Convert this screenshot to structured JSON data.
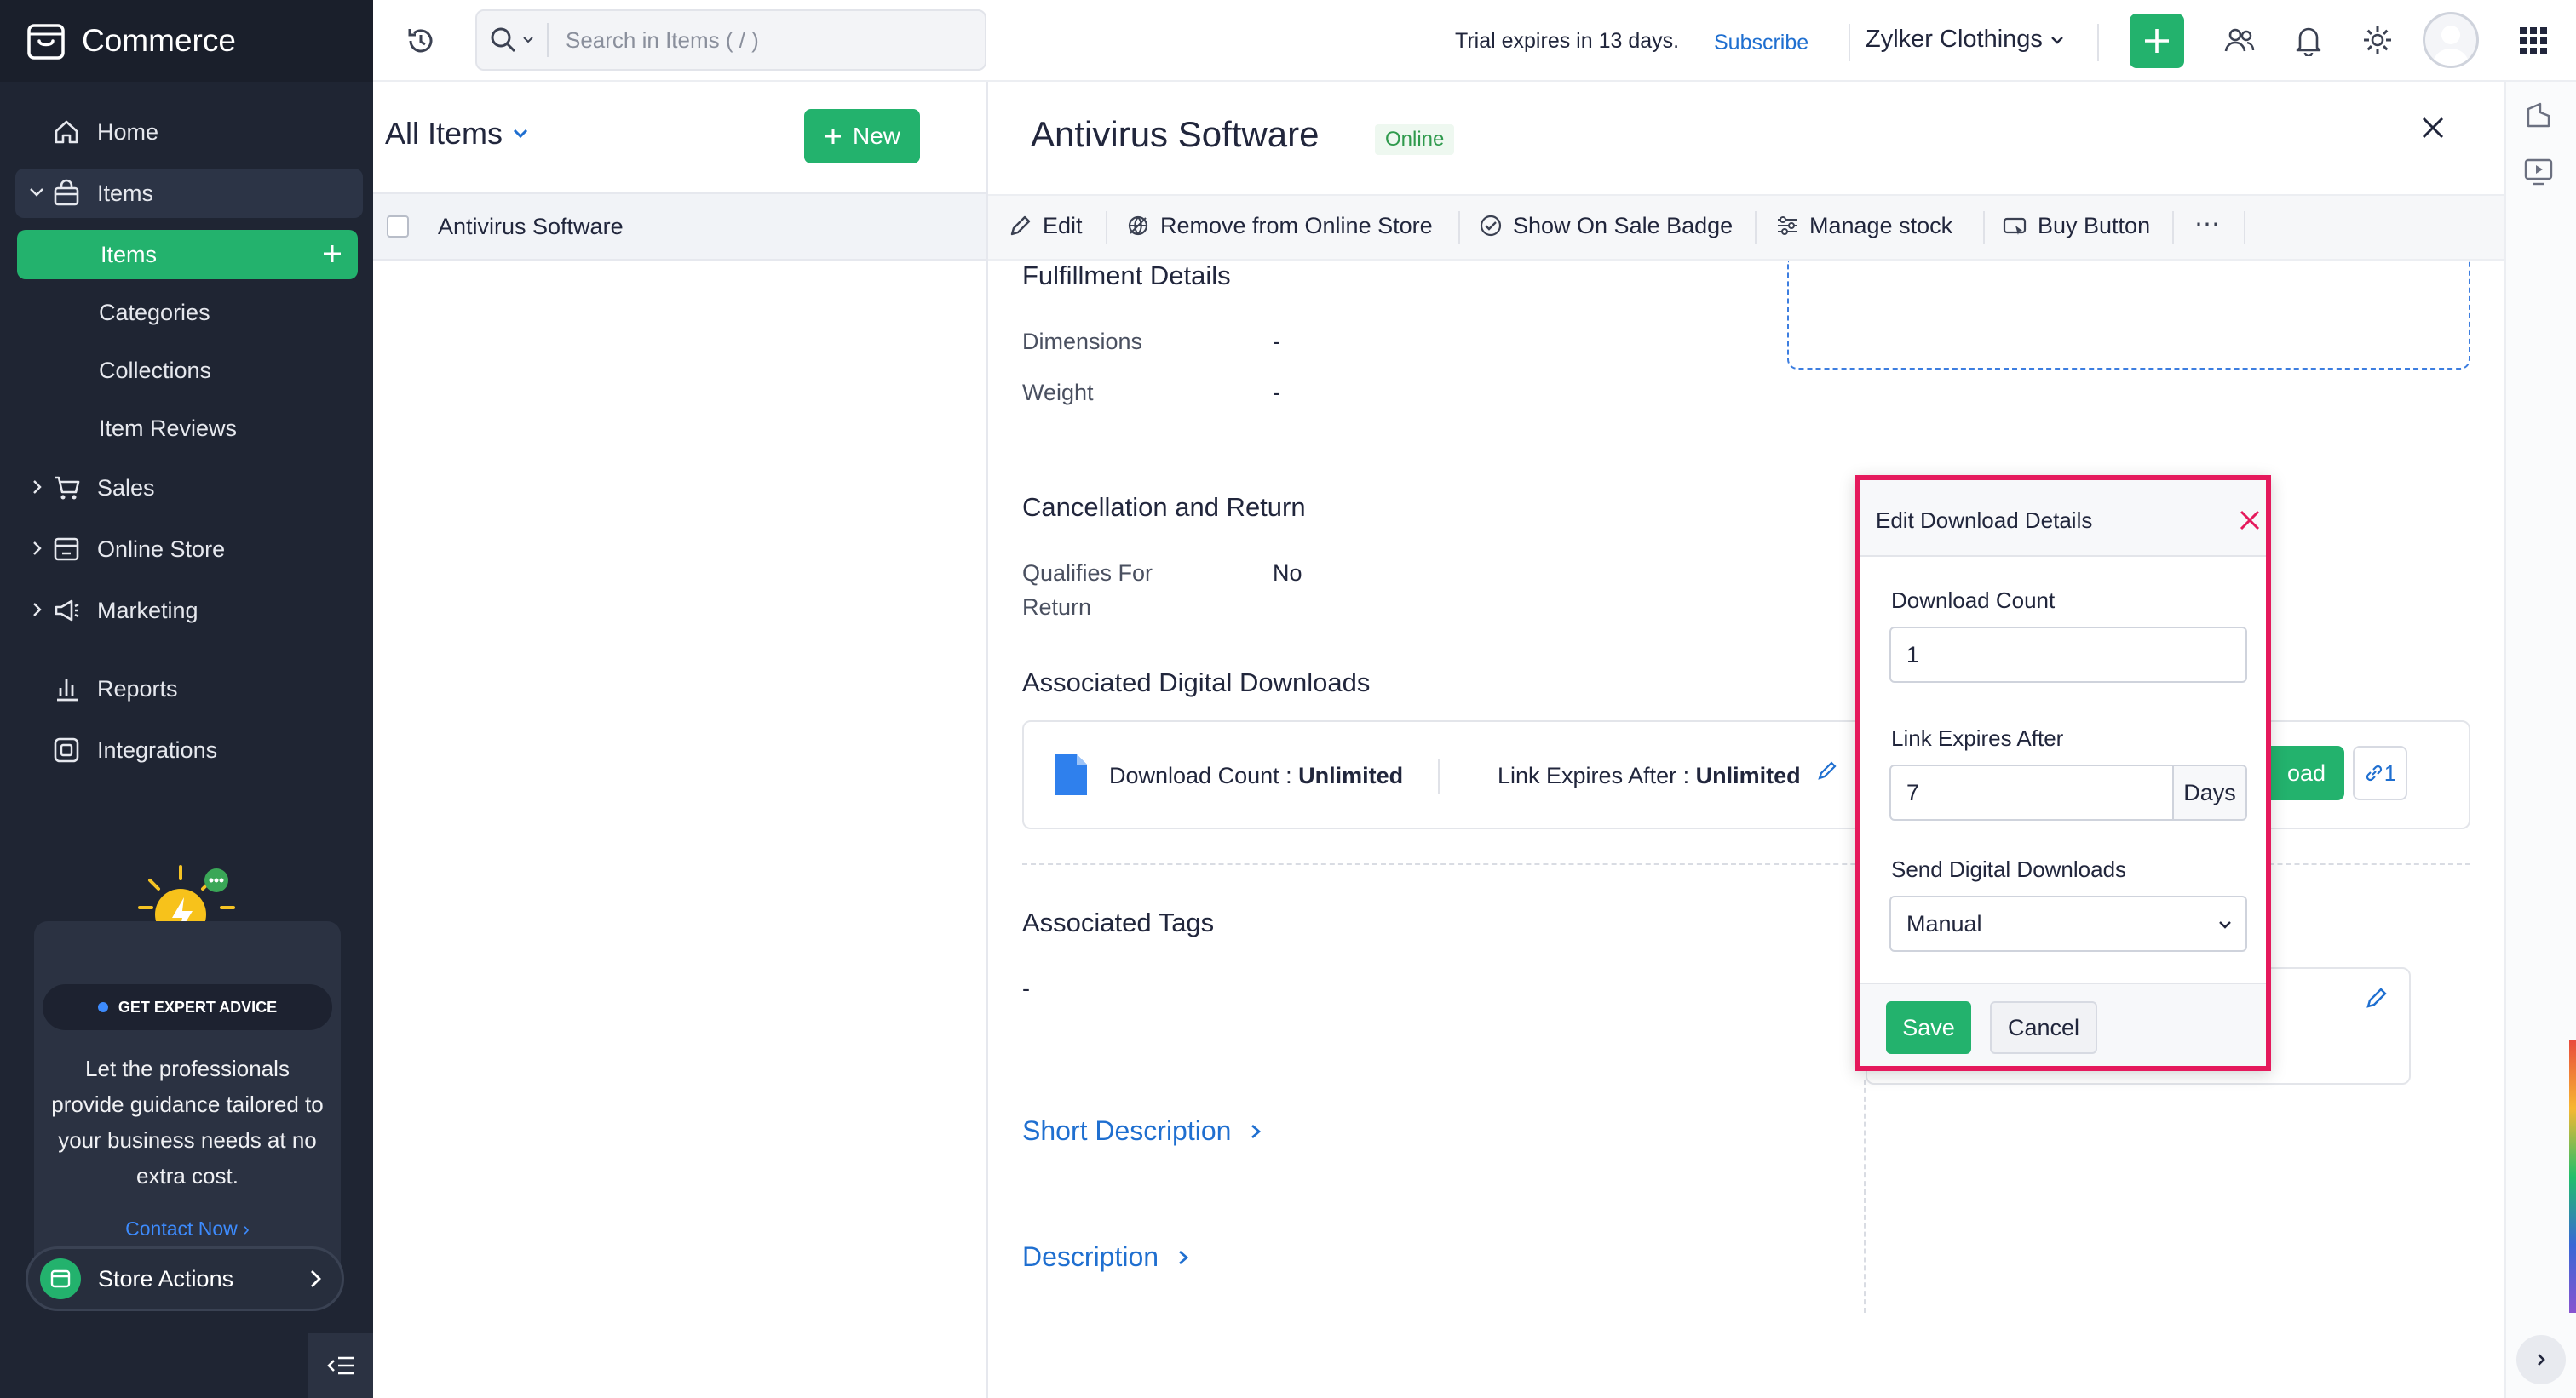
{
  "app": {
    "name": "Commerce"
  },
  "sidebar": {
    "items": [
      {
        "label": "Home"
      },
      {
        "label": "Items"
      },
      {
        "label": "Sales"
      },
      {
        "label": "Online Store"
      },
      {
        "label": "Marketing"
      },
      {
        "label": "Reports"
      },
      {
        "label": "Integrations"
      }
    ],
    "sub_items": [
      {
        "label": "Items"
      },
      {
        "label": "Categories"
      },
      {
        "label": "Collections"
      },
      {
        "label": "Item Reviews"
      }
    ],
    "promo": {
      "badge": "GET EXPERT ADVICE",
      "text": "Let the professionals provide guidance tailored to your business needs at no extra cost.",
      "link": "Contact Now"
    },
    "store_actions": "Store Actions"
  },
  "header": {
    "search_placeholder": "Search in Items ( / )",
    "trial_text": "Trial expires in 13 days.",
    "subscribe": "Subscribe",
    "org_name": "Zylker Clothings"
  },
  "list": {
    "title": "All Items",
    "new_button": "New",
    "rows": [
      {
        "name": "Antivirus Software"
      }
    ]
  },
  "detail": {
    "title": "Antivirus Software",
    "status_badge": "Online",
    "toolbar": {
      "edit": "Edit",
      "remove": "Remove from Online Store",
      "sale_badge": "Show On Sale Badge",
      "manage_stock": "Manage stock",
      "buy_button": "Buy Button",
      "more": "⋯"
    },
    "fulfillment": {
      "heading": "Fulfillment Details",
      "dimensions_label": "Dimensions",
      "dimensions_value": "-",
      "weight_label": "Weight",
      "weight_value": "-"
    },
    "cancellation": {
      "heading": "Cancellation and Return",
      "qualifies_label_1": "Qualifies For",
      "qualifies_label_2": "Return",
      "qualifies_value": "No"
    },
    "downloads": {
      "heading": "Associated Digital Downloads",
      "count_label": "Download Count : ",
      "count_value": "Unlimited",
      "expires_label": "Link Expires After : ",
      "expires_value": "Unlimited",
      "upload_partial": "oad",
      "link_count": "1"
    },
    "tags": {
      "heading": "Associated Tags",
      "value": "-"
    },
    "short_description": "Short Description",
    "description": "Description"
  },
  "modal": {
    "title": "Edit Download Details",
    "download_count_label": "Download Count",
    "download_count_value": "1",
    "link_expires_label": "Link Expires After",
    "link_expires_value": "7",
    "link_expires_unit": "Days",
    "send_label": "Send Digital Downloads",
    "send_value": "Manual",
    "save": "Save",
    "cancel": "Cancel"
  },
  "colors": {
    "accent": "#22b06e",
    "link": "#1f6fd0",
    "modal_border": "#e5195c",
    "sidebar_bg": "#1f2533"
  }
}
